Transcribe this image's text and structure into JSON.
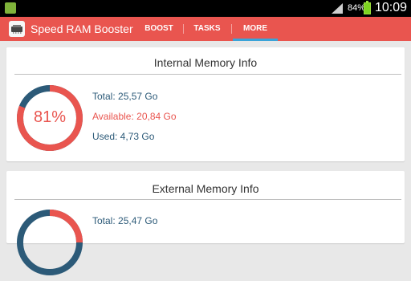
{
  "status_bar": {
    "battery": "84%",
    "time": "10:09"
  },
  "app_bar": {
    "title": "Speed RAM Booster",
    "tabs": [
      {
        "label": "BOOST",
        "active": false
      },
      {
        "label": "TASKS",
        "active": false
      },
      {
        "label": "MORE",
        "active": true
      }
    ]
  },
  "internal": {
    "title": "Internal Memory Info",
    "percent": "81%",
    "used_fraction": 0.81,
    "total": "Total: 25,57 Go",
    "available": "Available: 20,84 Go",
    "used": "Used: 4,73 Go"
  },
  "external": {
    "title": "External Memory Info",
    "total": "Total: 25,47 Go"
  },
  "colors": {
    "accent": "#e9554f",
    "ring_track": "#2c5a78",
    "tab_indicator": "#3aa3d8"
  }
}
